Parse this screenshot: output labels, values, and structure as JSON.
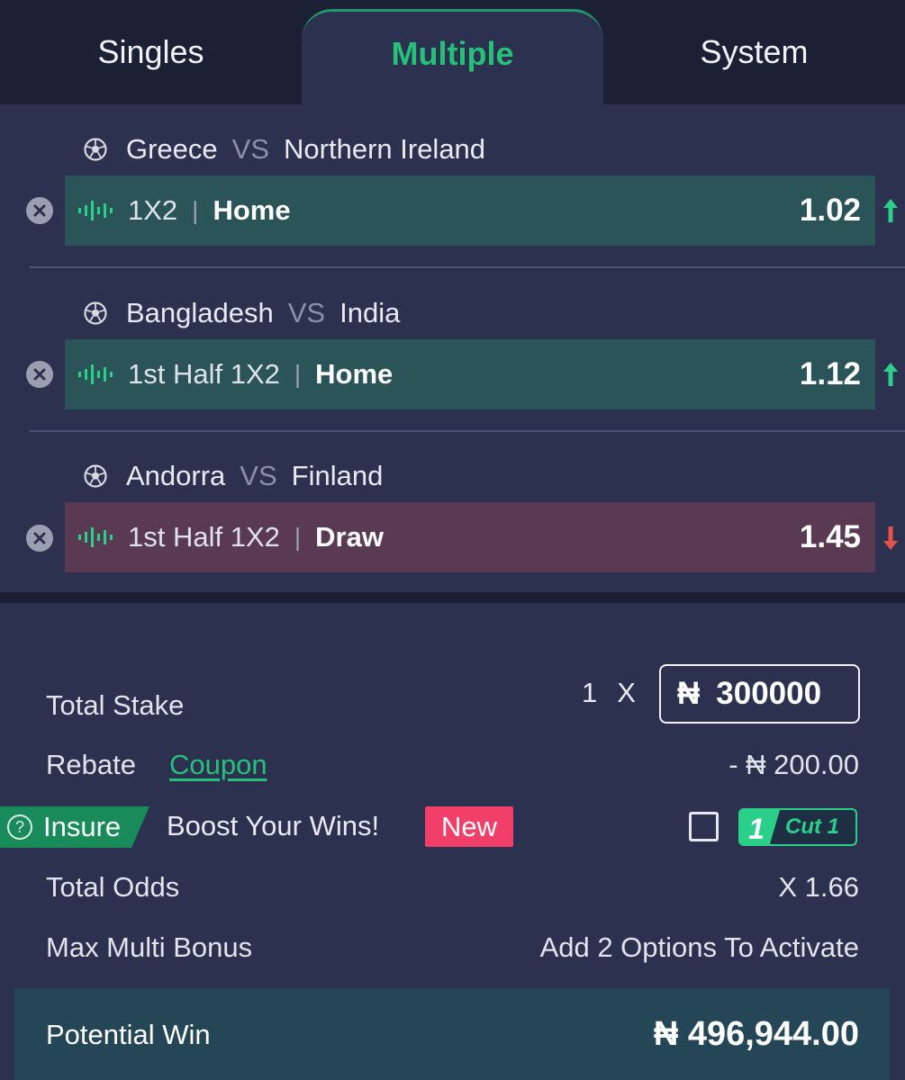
{
  "tabs": [
    {
      "label": "Singles",
      "active": false
    },
    {
      "label": "Multiple",
      "active": true
    },
    {
      "label": "System",
      "active": false
    }
  ],
  "bets": [
    {
      "home": "Greece",
      "vs": "VS",
      "away": "Northern Ireland",
      "market": "1X2",
      "pick": "Home",
      "odds": "1.02",
      "trend": "up"
    },
    {
      "home": "Bangladesh",
      "vs": "VS",
      "away": "India",
      "market": "1st Half 1X2",
      "pick": "Home",
      "odds": "1.12",
      "trend": "up"
    },
    {
      "home": "Andorra",
      "vs": "VS",
      "away": "Finland",
      "market": "1st Half 1X2",
      "pick": "Draw",
      "odds": "1.45",
      "trend": "down"
    }
  ],
  "separator": "|",
  "summary": {
    "total_stake_label": "Total Stake",
    "stake_multiplier": "1",
    "stake_times": "X",
    "currency": "₦",
    "stake_value": "300000",
    "rebate_label": "Rebate",
    "coupon_label": "Coupon",
    "rebate_value": "- ₦ 200.00",
    "insure_label": "Insure",
    "insure_help": "?",
    "boost_label": "Boost Your Wins!",
    "new_badge": "New",
    "cut_badge_number": "1",
    "cut_badge_text": "Cut 1",
    "insure_checked": false,
    "total_odds_label": "Total Odds",
    "total_odds_value": "X 1.66",
    "max_bonus_label": "Max Multi Bonus",
    "max_bonus_value": "Add 2 Options To Activate",
    "potential_win_label": "Potential Win",
    "potential_win_value": "₦ 496,944.00"
  },
  "colors": {
    "accent_green": "#27c078",
    "odds_up": "#2ad08a",
    "odds_down": "#e8504a",
    "badge_new": "#f23f6a"
  }
}
